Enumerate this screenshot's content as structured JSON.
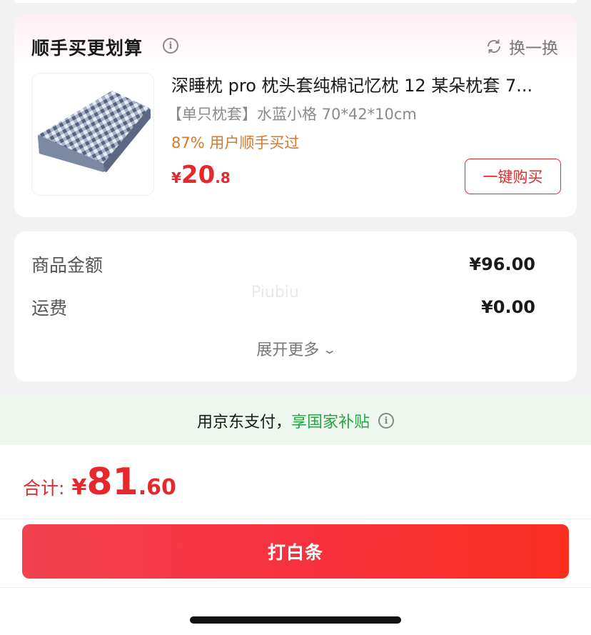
{
  "upsell": {
    "title": "顺手买更划算",
    "swap_label": "换一换",
    "product": {
      "name": "深睡枕 pro 枕头套纯棉记忆枕 12 某朵枕套 7...",
      "spec": "【单只枕套】水蓝小格 70*42*10cm",
      "buyers": "87% 用户顺手买过",
      "price_symbol": "¥",
      "price_int": "20",
      "price_dec": ".8",
      "buy_button": "一键购买"
    }
  },
  "summary": {
    "goods_label": "商品金额",
    "goods_value": "¥96.00",
    "shipping_label": "运费",
    "shipping_value": "¥0.00",
    "watermark": "Piubiu",
    "expand_label": "展开更多"
  },
  "subsidy": {
    "prefix": "用京东支付，",
    "highlight": "享国家补贴"
  },
  "checkout": {
    "total_label": "合计:",
    "total_symbol": "¥",
    "total_int": "81",
    "total_dec": ".60",
    "pay_button": "打白条"
  },
  "colors": {
    "accent_red": "#e4282b",
    "buyers_orange": "#d9782a",
    "subsidy_green": "#26a544",
    "subsidy_bg": "#edf7ee"
  },
  "icons": [
    "info-icon",
    "refresh-icon",
    "chevron-down-icon",
    "pillow-product-image"
  ]
}
